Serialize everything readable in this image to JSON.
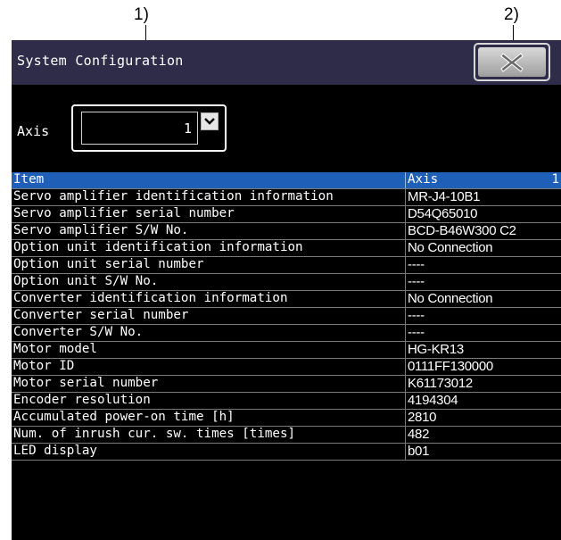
{
  "callouts": {
    "c1": "1)",
    "c2": "2)"
  },
  "window": {
    "title": "System Configuration",
    "close_icon": "close-x-icon"
  },
  "axis": {
    "label": "Axis",
    "value": "1"
  },
  "table": {
    "header": {
      "item": "Item",
      "axis_label": "Axis",
      "axis_num": "1"
    },
    "rows": [
      {
        "item": "Servo amplifier identification information",
        "value": "MR-J4-10B1"
      },
      {
        "item": "Servo amplifier serial number",
        "value": "D54Q65010"
      },
      {
        "item": "Servo amplifier S/W No.",
        "value": "BCD-B46W300 C2"
      },
      {
        "item": "Option unit identification information",
        "value": "No Connection"
      },
      {
        "item": "Option unit serial number",
        "value": "----"
      },
      {
        "item": "Option unit S/W No.",
        "value": "----"
      },
      {
        "item": "Converter identification information",
        "value": "No Connection"
      },
      {
        "item": "Converter serial number",
        "value": "----"
      },
      {
        "item": "Converter S/W No.",
        "value": "----"
      },
      {
        "item": "Motor model",
        "value": "HG-KR13"
      },
      {
        "item": "Motor ID",
        "value": "0111FF130000"
      },
      {
        "item": "Motor serial number",
        "value": "K61173012"
      },
      {
        "item": "Encoder resolution",
        "value": "4194304"
      },
      {
        "item": "Accumulated power-on time [h]",
        "value": "2810"
      },
      {
        "item": "Num. of inrush cur. sw. times [times]",
        "value": "482"
      },
      {
        "item": "LED display",
        "value": "b01"
      }
    ]
  }
}
